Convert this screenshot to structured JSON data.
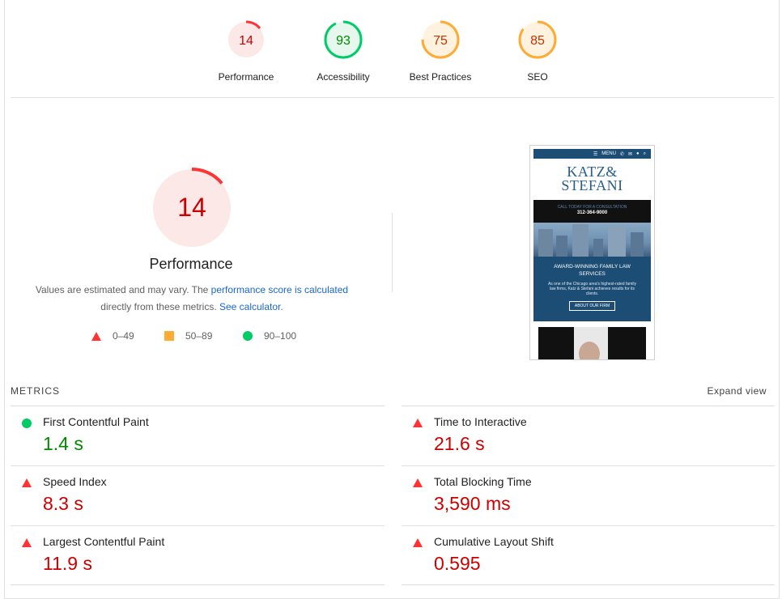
{
  "categories": [
    {
      "score": "14",
      "label": "Performance",
      "status": "fail",
      "fraction": 0.14
    },
    {
      "score": "93",
      "label": "Accessibility",
      "status": "pass",
      "fraction": 0.93
    },
    {
      "score": "75",
      "label": "Best Practices",
      "status": "average",
      "fraction": 0.75
    },
    {
      "score": "85",
      "label": "SEO",
      "status": "average",
      "fraction": 0.85
    }
  ],
  "performance": {
    "score": "14",
    "fraction": 0.14,
    "title": "Performance",
    "desc_before": "Values are estimated and may vary. The ",
    "desc_link": "performance score is calculated",
    "desc_middle": "directly from these metrics. ",
    "calc_link": "See calculator",
    "desc_end": "."
  },
  "legend": {
    "fail": "0–49",
    "average": "50–89",
    "pass": "90–100"
  },
  "colors": {
    "fail": "#ff3333",
    "fail_bg": "#fde8e8",
    "fail_text": "#cc0000",
    "average": "#ffaa33",
    "average_bg": "#fff3e0",
    "average_text": "#c33300",
    "pass": "#00cc66",
    "pass_bg": "#e6f7ee",
    "pass_text": "#008800",
    "link": "#1967d2"
  },
  "thumbnail": {
    "nav_menu": "MENU",
    "logo_line1": "KATZ&",
    "logo_line2": "STEFANI",
    "call_text": "CALL TODAY FOR A CONSULTATION",
    "phone": "312-364-9000",
    "headline": "AWARD-WINNING FAMILY LAW SERVICES",
    "body": "As one of the Chicago area's highest-rated family law firms, Katz & Stefani achieves results for its clients.",
    "button": "ABOUT OUR FIRM"
  },
  "metrics_section": {
    "heading": "METRICS",
    "expand": "Expand view"
  },
  "metrics": [
    {
      "name": "First Contentful Paint",
      "value": "1.4 s",
      "status": "pass"
    },
    {
      "name": "Time to Interactive",
      "value": "21.6 s",
      "status": "fail"
    },
    {
      "name": "Speed Index",
      "value": "8.3 s",
      "status": "fail"
    },
    {
      "name": "Total Blocking Time",
      "value": "3,590 ms",
      "status": "fail"
    },
    {
      "name": "Largest Contentful Paint",
      "value": "11.9 s",
      "status": "fail"
    },
    {
      "name": "Cumulative Layout Shift",
      "value": "0.595",
      "status": "fail"
    }
  ]
}
